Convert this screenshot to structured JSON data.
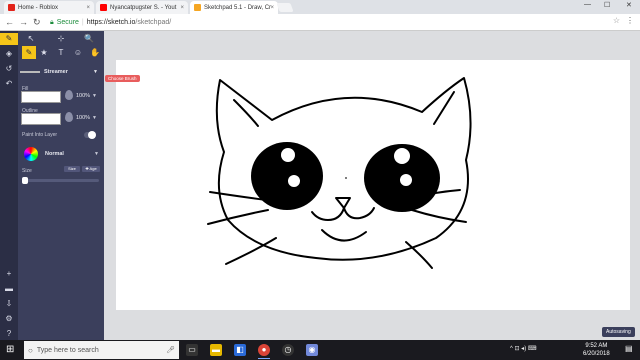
{
  "browser": {
    "tabs": [
      {
        "title": "Home - Roblox",
        "active": false,
        "favicon_color": "#e2231a"
      },
      {
        "title": "Nyancatpugster S. - Yout",
        "active": false,
        "favicon_color": "#ff0000"
      },
      {
        "title": "Sketchpad 5.1 - Draw, Cr",
        "active": true,
        "favicon_color": "#f5a623"
      }
    ],
    "tab_close": "×",
    "window_controls": {
      "minimize": "—",
      "maximize": "☐",
      "close": "✕"
    },
    "nav": {
      "back": "←",
      "forward": "→",
      "reload": "↻"
    },
    "security_label": "Secure",
    "url_host": "https://sketch.io",
    "url_path": "/sketchpad/",
    "bookmark_icon": "☆",
    "menu_icon": "⋮"
  },
  "toolbar": {
    "icons": [
      "paint-tools-icon",
      "layers-icon",
      "history-icon",
      "undo-icon"
    ],
    "glyphs": [
      "✎",
      "◈",
      "↺",
      "↶"
    ],
    "bottom_glyphs": [
      "+",
      "▬",
      "⇩",
      "⚙",
      "?"
    ]
  },
  "panel": {
    "tool_glyphs": [
      "↖",
      "⊹",
      "🔍",
      "✎",
      "★",
      "T",
      "☺",
      "✋"
    ],
    "brush_name": "Streamer",
    "fill_label": "Fill",
    "fill_opacity": "100%",
    "outline_label": "Outline",
    "outline_opacity": "100%",
    "paint_into_layer_label": "Paint Into Layer",
    "blend_mode": "Normal",
    "size_label": "Size",
    "size_buttons": [
      "Size",
      "✚ Age"
    ]
  },
  "tooltip": "Choose Brush",
  "status": {
    "autosave": "Autosaving"
  },
  "taskbar": {
    "start_glyph": "⊞",
    "search_placeholder": "Type here to search",
    "clock_time": "9:52 AM",
    "clock_date": "6/20/2018",
    "tray_glyph": "^ ⊡ ◂) ⌨"
  },
  "colors": {
    "toolbar_bg": "#2b2e45",
    "panel_bg": "#3b3f5c",
    "accent": "#f5c518",
    "tooltip_bg": "#e85d5d",
    "canvas_bg": "#dcdde0"
  }
}
